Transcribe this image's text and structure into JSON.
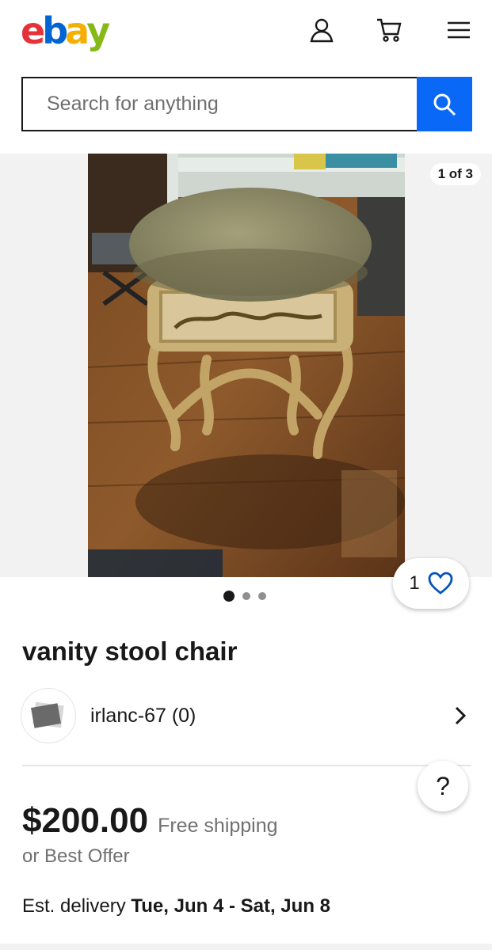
{
  "header": {
    "logo": {
      "e": "e",
      "b": "b",
      "a": "a",
      "y": "y"
    },
    "icons": [
      "account-icon",
      "cart-icon",
      "menu-icon"
    ]
  },
  "search": {
    "placeholder": "Search for anything"
  },
  "gallery": {
    "counter": "1 of 3",
    "watch_count": "1",
    "dots": 3,
    "active_dot": 1
  },
  "listing": {
    "title": "vanity stool chair",
    "seller": "irlanc-67 (0)",
    "price": "$200.00",
    "shipping": "Free shipping",
    "offer": "or Best Offer",
    "delivery_label": "Est. delivery",
    "delivery_dates": "Tue, Jun 4 - Sat, Jun 8"
  },
  "help_label": "?",
  "colors": {
    "ebay_red": "#e53238",
    "ebay_blue": "#0064d2",
    "ebay_yellow": "#f5af02",
    "ebay_green": "#86b817",
    "search_button": "#0968f6"
  }
}
